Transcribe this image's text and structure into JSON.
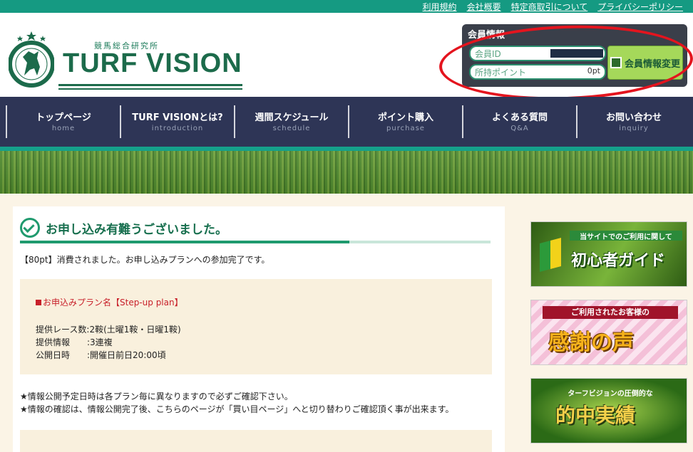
{
  "top_links": [
    "利用規約",
    "会社概要",
    "特定商取引について",
    "プライバシーポリシー"
  ],
  "logo": {
    "subtitle": "競馬総合研究所",
    "wordmark": "TURF VISION",
    "icon": "horse-emblem-icon"
  },
  "member": {
    "title": "会員情報",
    "id_label": "会員ID",
    "points_label": "所持ポイント",
    "points_value": "0pt",
    "edit_button": "会員情報変更"
  },
  "nav": [
    {
      "jp": "トップページ",
      "en": "home"
    },
    {
      "jp": "TURF VISIONとは?",
      "en": "introduction"
    },
    {
      "jp": "週間スケジュール",
      "en": "schedule"
    },
    {
      "jp": "ポイント購入",
      "en": "purchase"
    },
    {
      "jp": "よくある質問",
      "en": "Q&A"
    },
    {
      "jp": "お問い合わせ",
      "en": "inquiry"
    }
  ],
  "main": {
    "title": "お申し込み有難うございました。",
    "message": "【80pt】消費されました。お申し込みプランへの参加完了です。",
    "plan_name": "お申込みプラン名【Step-up plan】",
    "rows": [
      "提供レース数:2鞍(土曜1鞍・日曜1鞍)",
      "提供情報　　:3連複",
      "公開日時　　:開催日前日20:00頃"
    ],
    "notes": [
      "★情報公開予定日時は各プラン毎に異なりますので必ずご確認下さい。",
      "★情報の確認は、情報公開完了後、こちらのページが「買い目ページ」へと切り替わりご確認頂く事が出来ます。"
    ]
  },
  "banners": [
    {
      "small": "当サイトでのご利用に関して",
      "big": "初心者ガイド"
    },
    {
      "small": "ご利用されたお客様の",
      "big": "感謝の声"
    },
    {
      "small": "ターフビジョンの圧倒的な",
      "big": "的中実績"
    }
  ]
}
